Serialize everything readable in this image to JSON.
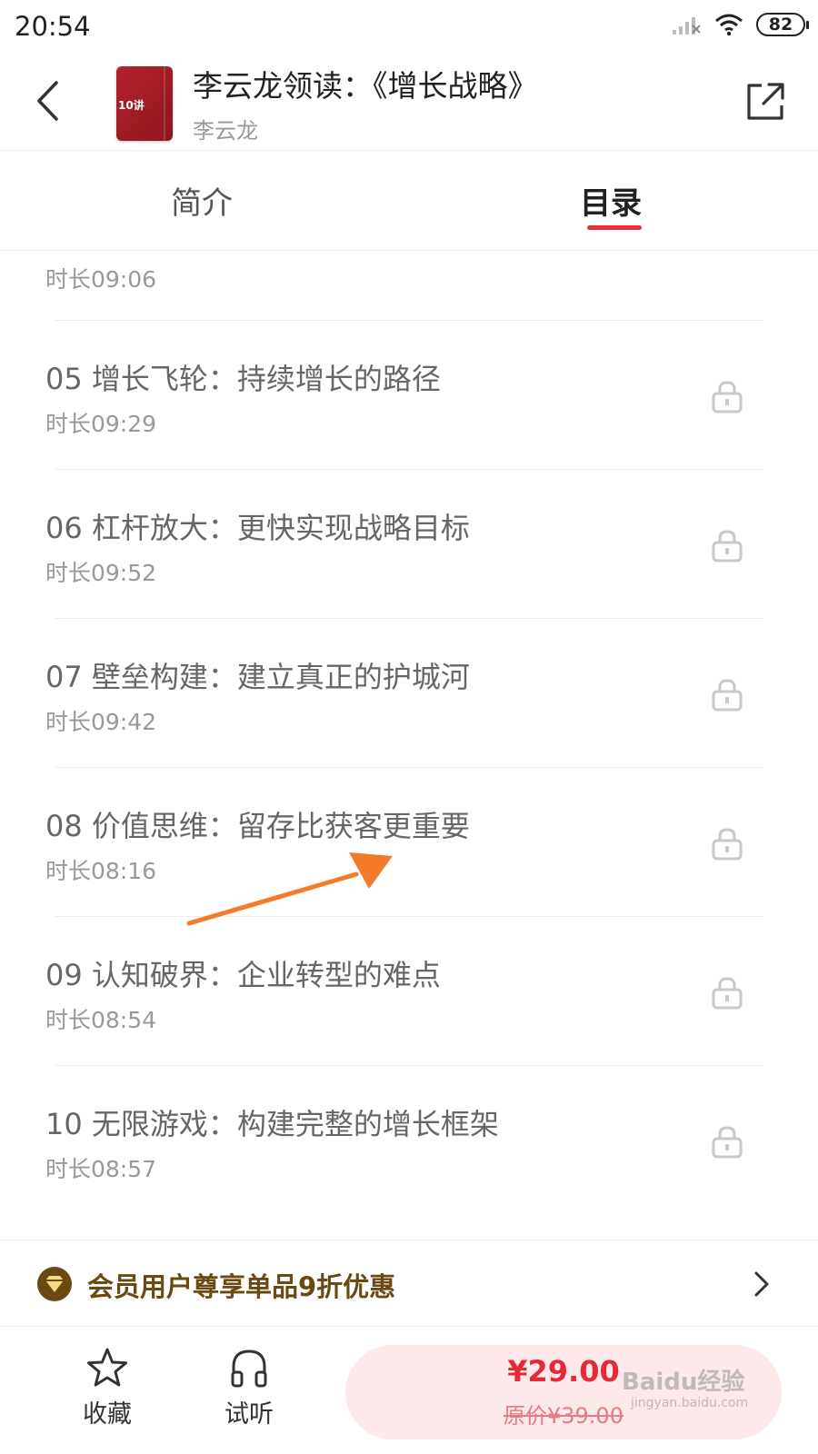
{
  "status_bar": {
    "time": "20:54",
    "battery": "82",
    "icons": [
      "signal-icon",
      "wifi-icon",
      "battery-icon"
    ]
  },
  "header": {
    "title": "李云龙领读：《增长战略》",
    "author": "李云龙",
    "cover_label": "10讲",
    "back_icon": "chevron-left-icon",
    "share_icon": "share-icon"
  },
  "tabs": [
    {
      "label": "简介",
      "active": false
    },
    {
      "label": "目录",
      "active": true
    }
  ],
  "tab_accent_color": "#e9303d",
  "partial_item": {
    "duration": "时长09:06"
  },
  "items": [
    {
      "title": "05 增长飞轮：持续增长的路径",
      "duration": "时长09:29",
      "locked": true
    },
    {
      "title": "06 杠杆放大：更快实现战略目标",
      "duration": "时长09:52",
      "locked": true
    },
    {
      "title": "07 壁垒构建：建立真正的护城河",
      "duration": "时长09:42",
      "locked": true
    },
    {
      "title": "08 价值思维：留存比获客更重要",
      "duration": "时长08:16",
      "locked": true
    },
    {
      "title": "09 认知破界：企业转型的难点",
      "duration": "时长08:54",
      "locked": true
    },
    {
      "title": "10 无限游戏：构建完整的增长框架",
      "duration": "时长08:57",
      "locked": true
    }
  ],
  "promo": {
    "text": "会员用户尊享单品9折优惠",
    "icon": "vip-diamond-icon",
    "color": "#6b4a12"
  },
  "bottom_bar": {
    "favorite_label": "收藏",
    "listen_label": "试听",
    "price": "¥29.00",
    "original_price": "原价¥39.00",
    "price_color": "#e42a36"
  },
  "annotation": {
    "color": "#f47b2a"
  },
  "watermark": {
    "text": "Baidu经验",
    "sub": "jingyan.baidu.com"
  }
}
